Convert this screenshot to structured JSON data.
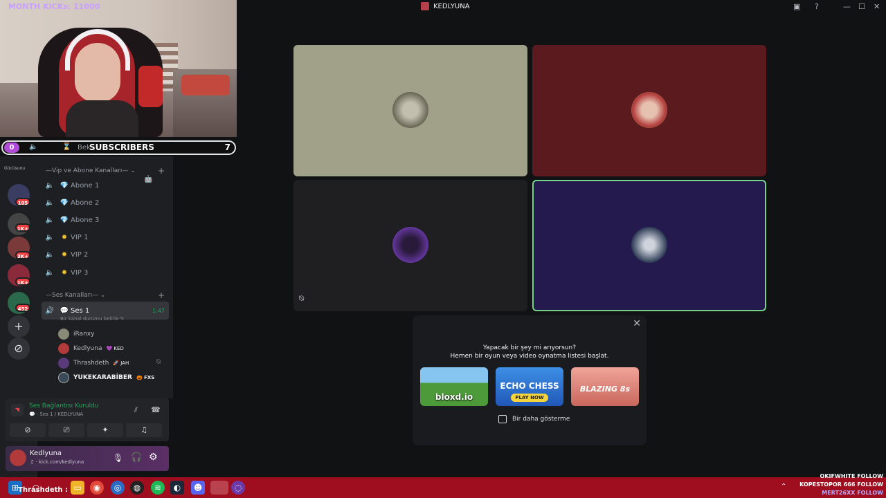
{
  "window": {
    "title": "KEDLYUNA"
  },
  "overlay": {
    "month_kicks": "MONTH KICKs: 11000",
    "subscribers_count": "0",
    "subscribers_label": "SUBSCRIBERS",
    "subscribers_goal": "7",
    "hidden_text": "Bek"
  },
  "rail": {
    "top_label": "Gücüsunu",
    "badges": [
      "105",
      "1K+",
      "3K+",
      "1K+",
      "452"
    ]
  },
  "channels": {
    "category_vip": "Vip ve Abone Kanalları",
    "vip_items": [
      {
        "label": "Abone 1",
        "icon": "diamond-icon"
      },
      {
        "label": "Abone 2",
        "icon": "diamond-icon"
      },
      {
        "label": "Abone 3",
        "icon": "diamond-icon"
      },
      {
        "label": "VIP 1",
        "icon": "sun-icon"
      },
      {
        "label": "VIP 2",
        "icon": "sun-icon"
      },
      {
        "label": "VIP 3",
        "icon": "sun-icon"
      }
    ],
    "category_voice": "Ses Kanalları",
    "active_channel": "Ses 1",
    "active_time": "1:47",
    "channel_status": "Bir kanal durumu belirle",
    "members": [
      {
        "name": "iRanxy",
        "tag": ""
      },
      {
        "name": "Kedlyuna",
        "tag": "💜 KED"
      },
      {
        "name": "Thrashdeth",
        "tag": "🚀 JAH"
      },
      {
        "name": "YUKEKARABİBER",
        "tag": "🎃 FXS"
      }
    ]
  },
  "voice_panel": {
    "status": "Ses Bağlantısı Kuruldu",
    "channel": "Ses 1 / KEDLYUNA"
  },
  "user_panel": {
    "name": "Kedlyuna",
    "status": "kick.com/kedlyuna"
  },
  "activity": {
    "question": "Yapacak bir şey mi arıyorsun?",
    "subtitle": "Hemen bir oyun veya video oynatma listesi başlat.",
    "games": [
      {
        "label": "bloxd.io",
        "color": "#4c9a3a"
      },
      {
        "label": "ECHO CHESS",
        "color": "#2f7fd8",
        "sub": "PLAY NOW"
      },
      {
        "label": "BLAZING 8s",
        "color": "#d46d62"
      }
    ],
    "dont_show": "Bir daha gösterme"
  },
  "taskbar": {
    "user": "Thrashdeth :",
    "follow_lines": [
      "OKIFWHITE FOLLOW",
      "KOPESTOPOR 666 FOLLOW",
      "MERT26XX FOLLOW"
    ]
  },
  "colors": {
    "accent_green": "#23a55a",
    "speaking_border": "#76d38a",
    "taskbar": "#9e0e1e",
    "notification": "#f23f43"
  }
}
